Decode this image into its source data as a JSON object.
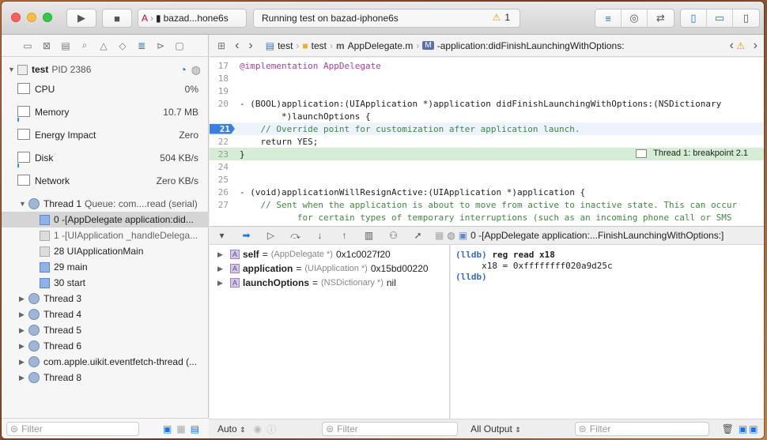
{
  "toolbar": {
    "scheme_name": "bazad...hone6s",
    "activity_text": "Running test on bazad-iphone6s",
    "warning_count": "1"
  },
  "navigator": {
    "process_name": "test",
    "process_pid": "PID 2386",
    "gauges": [
      {
        "label": "CPU",
        "value": "0%"
      },
      {
        "label": "Memory",
        "value": "10.7 MB"
      },
      {
        "label": "Energy Impact",
        "value": "Zero"
      },
      {
        "label": "Disk",
        "value": "504 KB/s"
      },
      {
        "label": "Network",
        "value": "Zero KB/s"
      }
    ],
    "thread1": "Thread 1",
    "thread1_queue": "Queue: com....read (serial)",
    "frames": [
      "0 -[AppDelegate application:did...",
      "1 -[UIApplication _handleDelega...",
      "28 UIApplicationMain",
      "29 main",
      "30 start"
    ],
    "threads": [
      "Thread 3",
      "Thread 4",
      "Thread 5",
      "Thread 6",
      "com.apple.uikit.eventfetch-thread (...",
      "Thread 8"
    ],
    "filter_placeholder": "Filter"
  },
  "jumpbar": {
    "crumbs": [
      "test",
      "test",
      "AppDelegate.m",
      "-application:didFinishLaunchingWithOptions:"
    ]
  },
  "editor": {
    "lines": [
      {
        "n": "17",
        "text": "@implementation AppDelegate"
      },
      {
        "n": "18",
        "text": ""
      },
      {
        "n": "19",
        "text": ""
      },
      {
        "n": "20",
        "text": "- (BOOL)application:(UIApplication *)application didFinishLaunchingWithOptions:(NSDictionary"
      },
      {
        "n": "",
        "text": "        *)launchOptions {"
      },
      {
        "n": "21",
        "text": "    // Override point for customization after application launch."
      },
      {
        "n": "22",
        "text": "    return YES;"
      },
      {
        "n": "23",
        "text": "}"
      },
      {
        "n": "24",
        "text": ""
      },
      {
        "n": "25",
        "text": ""
      },
      {
        "n": "26",
        "text": "- (void)applicationWillResignActive:(UIApplication *)application {"
      },
      {
        "n": "27",
        "text": "    // Sent when the application is about to move from active to inactive state. This can occur"
      },
      {
        "n": "",
        "text": "           for certain types of temporary interruptions (such as an incoming phone call or SMS"
      }
    ],
    "breakpoint_label": "Thread 1: breakpoint 2.1"
  },
  "debug": {
    "frame_label": "0 -[AppDelegate application:...FinishLaunchingWithOptions:]",
    "variables": [
      {
        "name": "self",
        "type": "(AppDelegate *)",
        "value": "0x1c0027f20"
      },
      {
        "name": "application",
        "type": "(UIApplication *)",
        "value": "0x15bd00220"
      },
      {
        "name": "launchOptions",
        "type": "(NSDictionary *)",
        "value": "nil"
      }
    ],
    "console": {
      "prompt": "(lldb)",
      "command": "reg read x18",
      "output": "     x18 = 0xffffffff020a9d25c"
    },
    "auto_label": "Auto",
    "filter_placeholder": "Filter",
    "output_label": "All Output"
  }
}
